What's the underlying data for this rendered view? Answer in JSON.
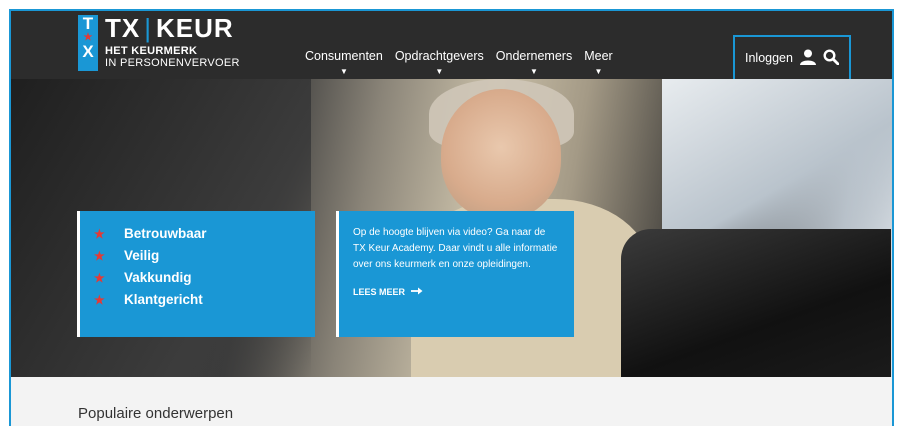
{
  "logo": {
    "badge_top": "T",
    "badge_bottom": "X",
    "title_left": "TX",
    "title_right": "KEUR",
    "sub_line1": "HET KEURMERK",
    "sub_line2": "IN PERSONENVERVOER"
  },
  "nav": {
    "items": [
      {
        "label": "Consumenten"
      },
      {
        "label": "Opdrachtgevers"
      },
      {
        "label": "Ondernemers"
      },
      {
        "label": "Meer"
      }
    ],
    "login_label": "Inloggen"
  },
  "hero": {
    "bullets": [
      "Betrouwbaar",
      "Veilig",
      "Vakkundig",
      "Klantgericht"
    ],
    "info_text": "Op de hoogte blijven via video? Ga naar de TX Keur Academy. Daar vindt u alle informatie over ons keurmerk en onze opleidingen.",
    "read_more_label": "LEES MEER"
  },
  "content": {
    "section_title": "Populaire onderwerpen"
  },
  "colors": {
    "brand_blue": "#1a97d5",
    "nav_dark": "#2c2c2c",
    "star_red": "#e53935"
  },
  "icons": {
    "user": "user-icon",
    "search": "search-icon",
    "arrow": "arrow-right-icon"
  }
}
